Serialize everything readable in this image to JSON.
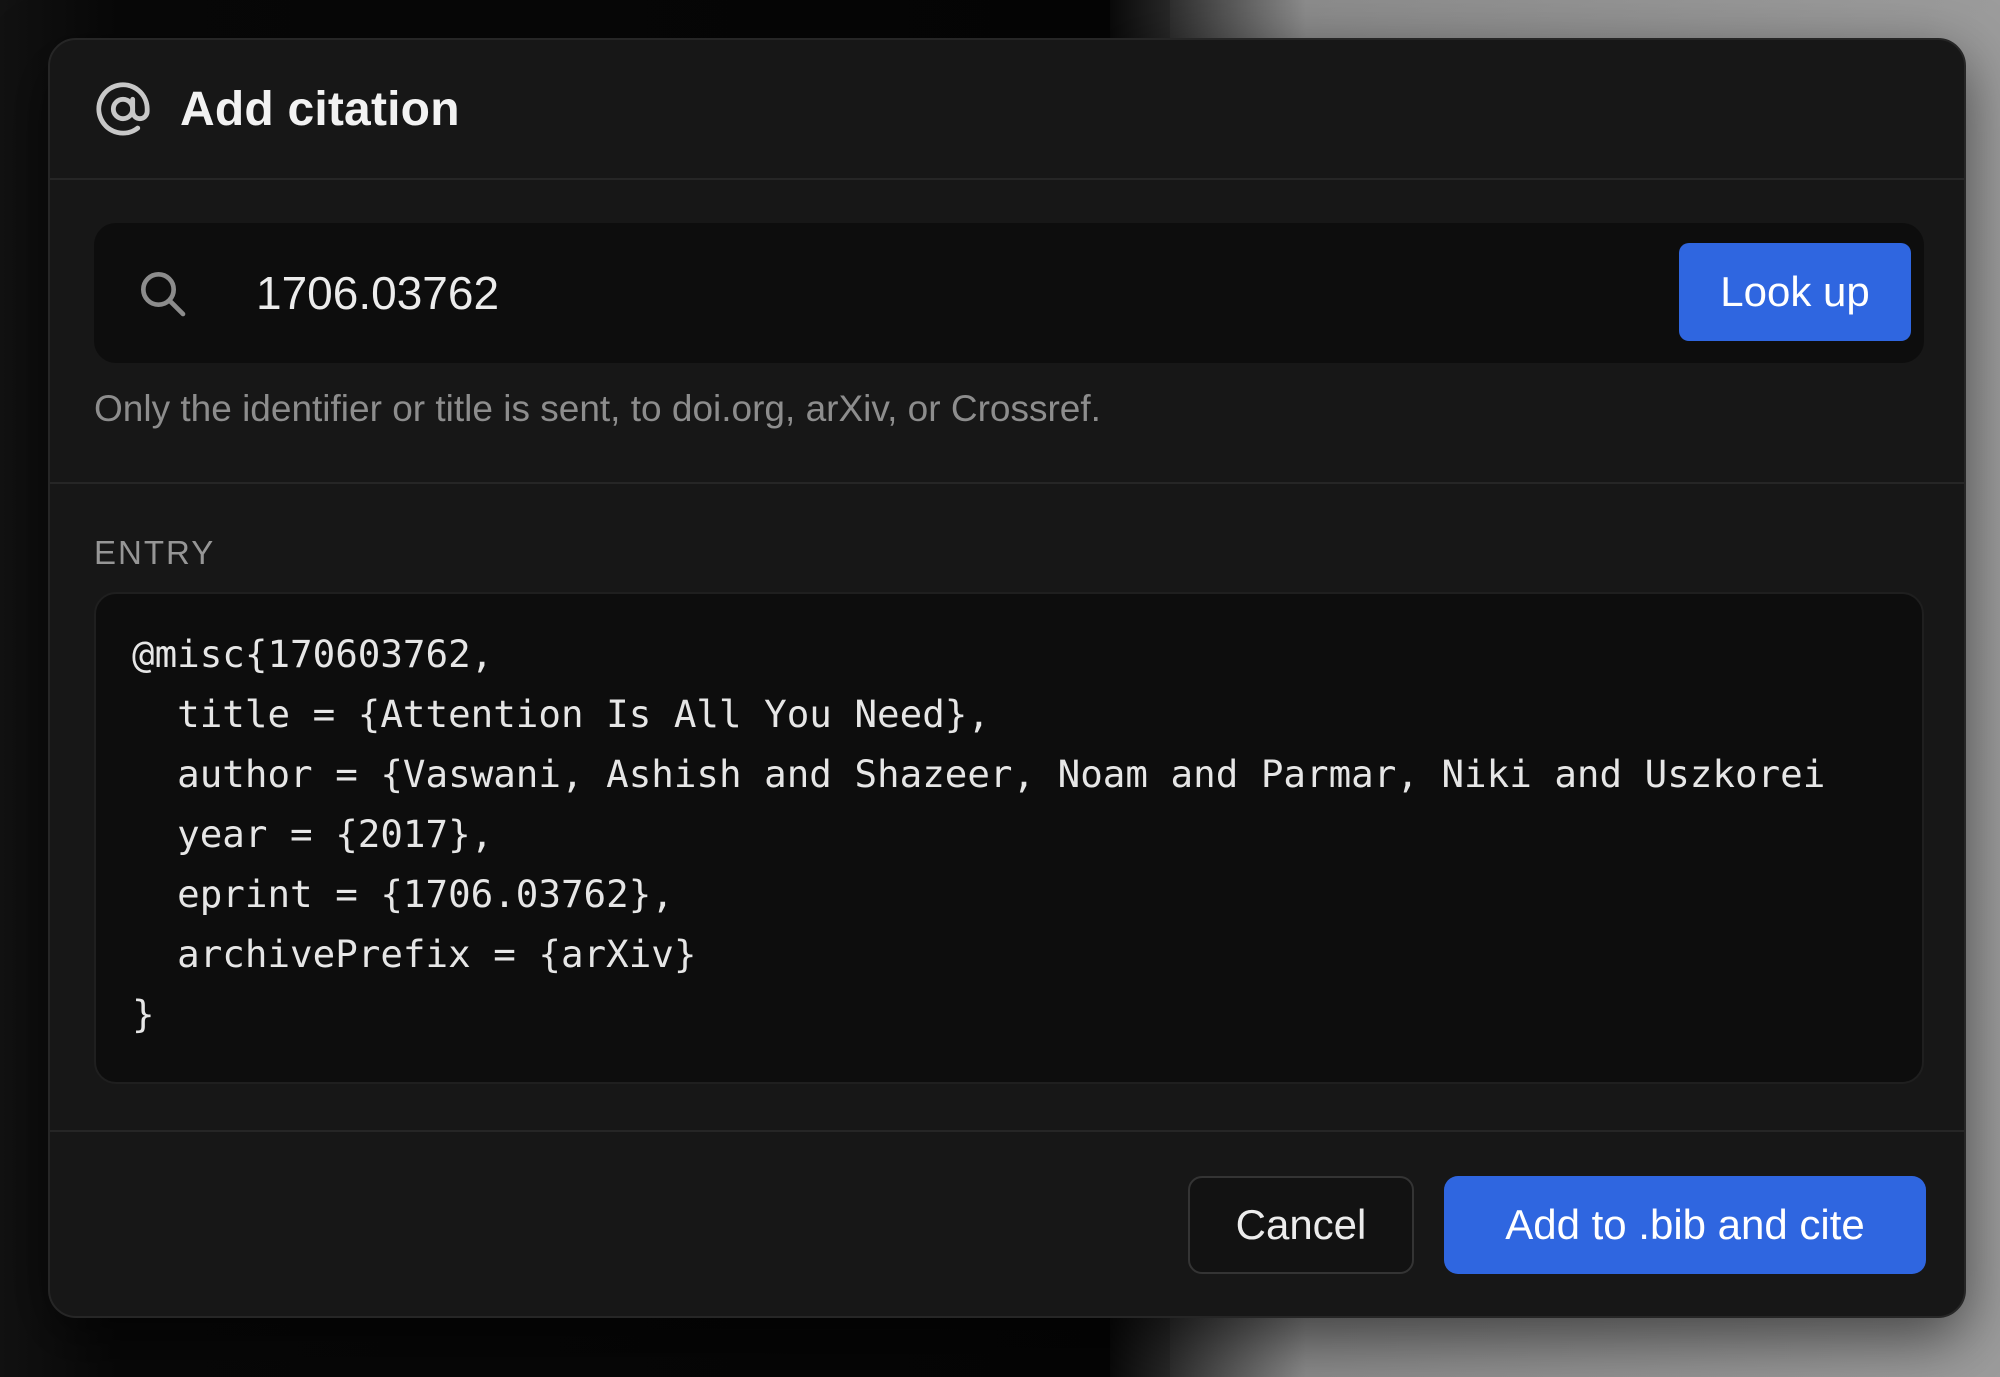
{
  "dialog": {
    "title": "Add citation",
    "header_icon": "at-icon"
  },
  "lookup": {
    "search_icon": "search-icon",
    "input_value": "1706.03762",
    "button_label": "Look up",
    "helper_text": "Only the identifier or title is sent, to doi.org, arXiv, or Crossref."
  },
  "entry": {
    "label": "ENTRY",
    "code_lines": [
      "@misc{170603762,",
      "  title = {Attention Is All You Need},",
      "  author = {Vaswani, Ashish and Shazeer, Noam and Parmar, Niki and Uszkorei",
      "  year = {2017},",
      "  eprint = {1706.03762},",
      "  archivePrefix = {arXiv}",
      "}"
    ]
  },
  "footer": {
    "cancel_label": "Cancel",
    "primary_label": "Add to .bib and cite"
  },
  "colors": {
    "accent": "#2f66e0",
    "surface": "#171717",
    "input_surface": "#0d0d0d"
  }
}
